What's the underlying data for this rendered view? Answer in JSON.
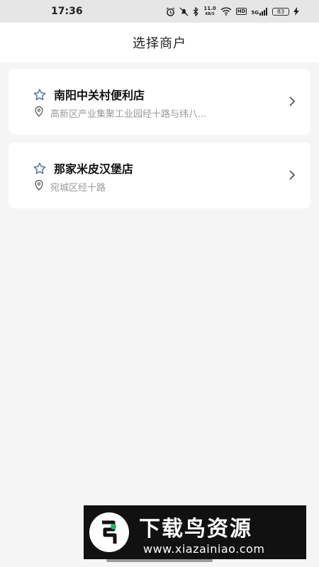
{
  "status_bar": {
    "time": "17:36",
    "net_speed_value": "11.0",
    "net_speed_unit": "KB/S",
    "hd": "HD",
    "network": "5G",
    "battery": "83",
    "icons": [
      "alarm-icon",
      "mute-icon",
      "bluetooth-icon",
      "wifi-icon",
      "signal-icon",
      "battery-icon",
      "charging-icon"
    ]
  },
  "header": {
    "title": "选择商户"
  },
  "merchants": [
    {
      "name": "南阳中关村便利店",
      "address": "高新区产业集聚工业园经十路与纬八...",
      "icon": "star-icon"
    },
    {
      "name": "那家米皮汉堡店",
      "address": "宛城区经十路",
      "icon": "star-icon"
    }
  ],
  "watermark": {
    "title": "下载鸟资源",
    "url": "www.xiazainiao.com"
  },
  "colors": {
    "background": "#f5f5f5",
    "card": "#ffffff",
    "star": "#5a73a8",
    "muted_text": "#999999"
  }
}
